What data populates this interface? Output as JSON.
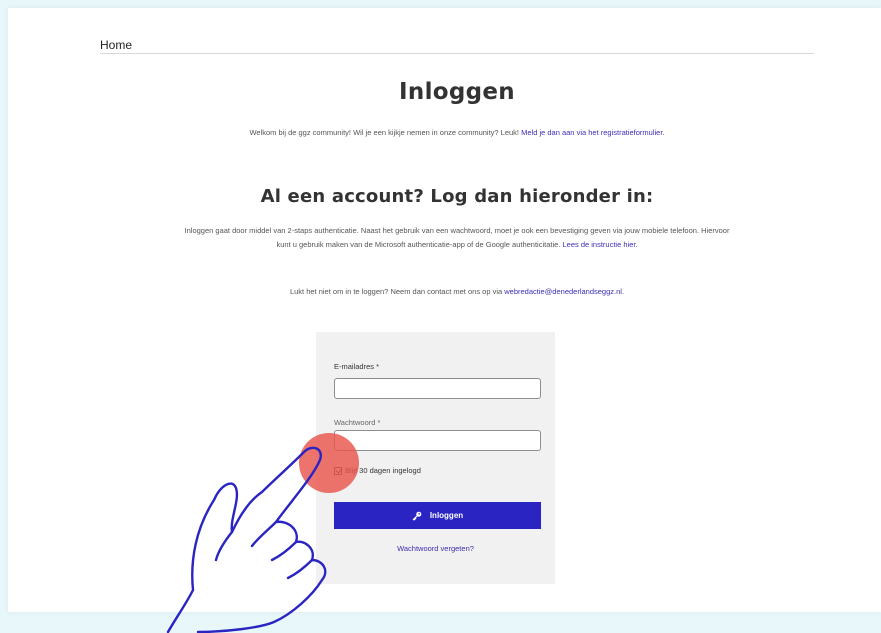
{
  "nav": {
    "home": "Home"
  },
  "main": {
    "title": "Inloggen",
    "welcome_text": "Welkom bij de ggz community! Wil je een kijkje nemen in onze community? Leuk! ",
    "welcome_link": "Meld je dan aan via het registratieformulier.",
    "subtitle": "Al een account? Log dan hieronder in:",
    "intro_text": "Inloggen gaat door middel van 2-staps authenticatie. Naast het gebruik van een wachtwoord, moet je ook een bevestiging geven via jouw mobiele telefoon. Hiervoor kunt u gebruik maken van de Microsoft authenticatie-app of de Google authenticitatie. ",
    "intro_link": "Lees de instructie hier.",
    "help_text": "Lukt het niet om in te loggen? Neem dan contact met ons op via ",
    "help_link": "webredactie@denederlandseggz.nl",
    "help_end": "."
  },
  "form": {
    "email_label": "E-mailadres *",
    "email_value": "",
    "password_label": "Wachtwoord *",
    "password_value": "",
    "remember_label": "Blijf 30 dagen ingelogd",
    "remember_checked": true,
    "submit_label": "Inloggen",
    "forgot_label": "Wachtwoord vergeten?"
  },
  "icons": {
    "password_toggle": "eye-icon",
    "submit": "key-icon",
    "pointer": "hand-pointer-icon"
  },
  "colors": {
    "primary": "#2a24c2",
    "link": "#3a2fb5",
    "highlight": "#e8564c",
    "background": "#e8f8fa"
  }
}
